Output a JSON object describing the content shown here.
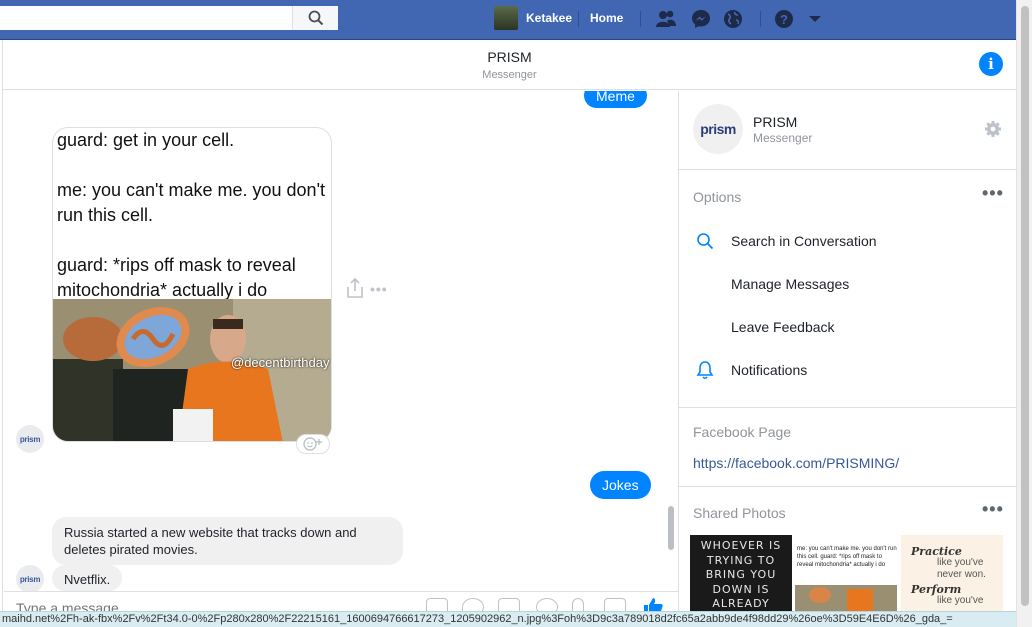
{
  "topbar": {
    "profile_name": "Ketakee",
    "home_label": "Home"
  },
  "header": {
    "title": "PRISM",
    "subtitle": "Messenger"
  },
  "chat": {
    "out_message_1": "Meme",
    "meme_caption": "guard: get in your cell.\n\nme: you can't make me. you don't run this cell.\n\nguard: *rips off mask to reveal mitochondria* actually i do",
    "meme_watermark": "@decentbirthday",
    "out_message_2": "Jokes",
    "in_message_1": "Russia started a new website that tracks down and deletes pirated movies.",
    "in_message_2": "Nvetflix.",
    "avatar_label": "prism"
  },
  "composer": {
    "placeholder": "Type a message..."
  },
  "sidebar": {
    "name": "PRISM",
    "subtitle": "Messenger",
    "logo_text": "prism",
    "options_title": "Options",
    "options": [
      {
        "label": "Search in Conversation",
        "icon": "search-icon"
      },
      {
        "label": "Manage Messages",
        "icon": ""
      },
      {
        "label": "Leave Feedback",
        "icon": ""
      },
      {
        "label": "Notifications",
        "icon": "bell-icon"
      }
    ],
    "fb_page_title": "Facebook Page",
    "fb_page_link": "https://facebook.com/PRISMING/",
    "shared_photos_title": "Shared Photos",
    "photo_1_text": "WHOEVER IS TRYING TO BRING YOU DOWN IS ALREADY",
    "photo_2_text": "me: you can't make me. you don't run this cell. guard: *rips off mask to reveal mitochondria* actually i do",
    "photo_3_text_1": "Practice",
    "photo_3_text_2": "like you've never won.",
    "photo_3_text_3": "Perform",
    "photo_3_text_4": "like you've"
  },
  "statusbar": {
    "url": "maihd.net%2Fh-ak-fbx%2Fv%2Ft34.0-0%2Fp280x280%2F22215161_1600694766617273_1205902962_n.jpg%3Foh%3D9c3a789018d2fc65a2abb9de4f98dd29%26oe%3D59E4E6D%26_gda_="
  },
  "colors": {
    "brand": "#4267b2",
    "accent": "#0084ff",
    "link": "#365899"
  }
}
